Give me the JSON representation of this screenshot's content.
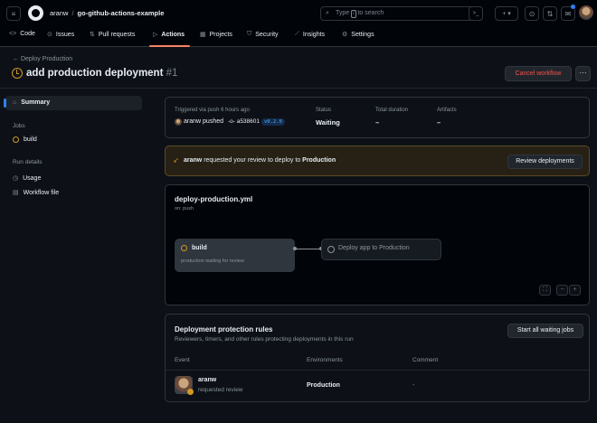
{
  "header": {
    "owner": "aranw",
    "separator": "/",
    "repo": "go-github-actions-example",
    "search_placeholder": "Type",
    "search_key": "/",
    "search_suffix": "to search",
    "terminal_label": ">_",
    "plus_label": "+ ▾",
    "icons": [
      "menu-icon",
      "github-logo",
      "search-icon",
      "command-palette-icon",
      "plus-icon",
      "issues-icon",
      "pull-requests-icon",
      "inbox-icon",
      "avatar"
    ]
  },
  "nav": {
    "code": "Code",
    "issues": "Issues",
    "pull_requests": "Pull requests",
    "actions": "Actions",
    "projects": "Projects",
    "security": "Security",
    "insights": "Insights",
    "settings": "Settings"
  },
  "page": {
    "breadcrumb": "← Deploy Production",
    "title": "add production deployment",
    "run_number": "#1",
    "cancel_label": "Cancel workflow",
    "more_label": "···"
  },
  "sidebar": {
    "summary": "Summary",
    "jobs_heading": "Jobs",
    "job_build": "build",
    "run_details_heading": "Run details",
    "usage": "Usage",
    "workflow_file": "Workflow file"
  },
  "summary": {
    "triggered": "Triggered via push 6 hours ago",
    "actor": "aranw",
    "pushed": "pushed",
    "commit": "-o- a538601",
    "tag": "v0.2.0",
    "status_label": "Status",
    "status_value": "Waiting",
    "duration_label": "Total duration",
    "duration_value": "–",
    "artifacts_label": "Artifacts",
    "artifacts_value": "–"
  },
  "review": {
    "actor": "aranw",
    "text_before": "requested your review to deploy to",
    "environment": "Production",
    "button": "Review deployments"
  },
  "workflow": {
    "file": "deploy-production.yml",
    "trigger": "on: push",
    "job_name": "build",
    "job_status": "production waiting for review",
    "deploy_label": "Deploy app to Production",
    "zoom_fit": "⛶",
    "zoom_out": "−",
    "zoom_in": "+"
  },
  "protection": {
    "title": "Deployment protection rules",
    "subtitle": "Reviewers, timers, and other rules protecting deployments in this run",
    "button": "Start all waiting jobs",
    "col_event": "Event",
    "col_env": "Environments",
    "col_comment": "Comment",
    "row": {
      "user": "aranw",
      "action": "requested review",
      "environment": "Production",
      "comment": "-"
    }
  },
  "colors": {
    "accent": "#f78166",
    "waiting": "#d29922",
    "danger": "#f85149",
    "link": "#58a6ff"
  }
}
